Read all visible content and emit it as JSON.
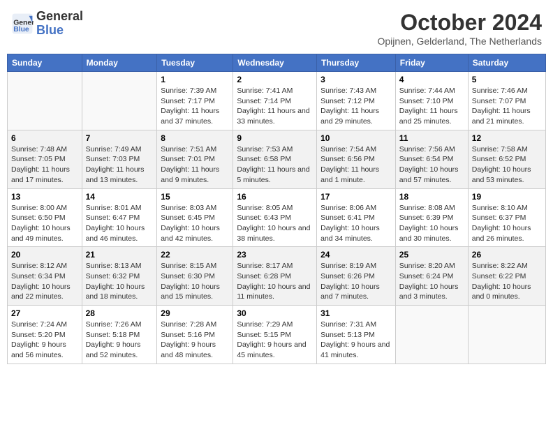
{
  "header": {
    "logo_line1": "General",
    "logo_line2": "Blue",
    "title": "October 2024",
    "subtitle": "Opijnen, Gelderland, The Netherlands"
  },
  "days_of_week": [
    "Sunday",
    "Monday",
    "Tuesday",
    "Wednesday",
    "Thursday",
    "Friday",
    "Saturday"
  ],
  "weeks": [
    [
      {
        "num": "",
        "info": ""
      },
      {
        "num": "",
        "info": ""
      },
      {
        "num": "1",
        "info": "Sunrise: 7:39 AM\nSunset: 7:17 PM\nDaylight: 11 hours and 37 minutes."
      },
      {
        "num": "2",
        "info": "Sunrise: 7:41 AM\nSunset: 7:14 PM\nDaylight: 11 hours and 33 minutes."
      },
      {
        "num": "3",
        "info": "Sunrise: 7:43 AM\nSunset: 7:12 PM\nDaylight: 11 hours and 29 minutes."
      },
      {
        "num": "4",
        "info": "Sunrise: 7:44 AM\nSunset: 7:10 PM\nDaylight: 11 hours and 25 minutes."
      },
      {
        "num": "5",
        "info": "Sunrise: 7:46 AM\nSunset: 7:07 PM\nDaylight: 11 hours and 21 minutes."
      }
    ],
    [
      {
        "num": "6",
        "info": "Sunrise: 7:48 AM\nSunset: 7:05 PM\nDaylight: 11 hours and 17 minutes."
      },
      {
        "num": "7",
        "info": "Sunrise: 7:49 AM\nSunset: 7:03 PM\nDaylight: 11 hours and 13 minutes."
      },
      {
        "num": "8",
        "info": "Sunrise: 7:51 AM\nSunset: 7:01 PM\nDaylight: 11 hours and 9 minutes."
      },
      {
        "num": "9",
        "info": "Sunrise: 7:53 AM\nSunset: 6:58 PM\nDaylight: 11 hours and 5 minutes."
      },
      {
        "num": "10",
        "info": "Sunrise: 7:54 AM\nSunset: 6:56 PM\nDaylight: 11 hours and 1 minute."
      },
      {
        "num": "11",
        "info": "Sunrise: 7:56 AM\nSunset: 6:54 PM\nDaylight: 10 hours and 57 minutes."
      },
      {
        "num": "12",
        "info": "Sunrise: 7:58 AM\nSunset: 6:52 PM\nDaylight: 10 hours and 53 minutes."
      }
    ],
    [
      {
        "num": "13",
        "info": "Sunrise: 8:00 AM\nSunset: 6:50 PM\nDaylight: 10 hours and 49 minutes."
      },
      {
        "num": "14",
        "info": "Sunrise: 8:01 AM\nSunset: 6:47 PM\nDaylight: 10 hours and 46 minutes."
      },
      {
        "num": "15",
        "info": "Sunrise: 8:03 AM\nSunset: 6:45 PM\nDaylight: 10 hours and 42 minutes."
      },
      {
        "num": "16",
        "info": "Sunrise: 8:05 AM\nSunset: 6:43 PM\nDaylight: 10 hours and 38 minutes."
      },
      {
        "num": "17",
        "info": "Sunrise: 8:06 AM\nSunset: 6:41 PM\nDaylight: 10 hours and 34 minutes."
      },
      {
        "num": "18",
        "info": "Sunrise: 8:08 AM\nSunset: 6:39 PM\nDaylight: 10 hours and 30 minutes."
      },
      {
        "num": "19",
        "info": "Sunrise: 8:10 AM\nSunset: 6:37 PM\nDaylight: 10 hours and 26 minutes."
      }
    ],
    [
      {
        "num": "20",
        "info": "Sunrise: 8:12 AM\nSunset: 6:34 PM\nDaylight: 10 hours and 22 minutes."
      },
      {
        "num": "21",
        "info": "Sunrise: 8:13 AM\nSunset: 6:32 PM\nDaylight: 10 hours and 18 minutes."
      },
      {
        "num": "22",
        "info": "Sunrise: 8:15 AM\nSunset: 6:30 PM\nDaylight: 10 hours and 15 minutes."
      },
      {
        "num": "23",
        "info": "Sunrise: 8:17 AM\nSunset: 6:28 PM\nDaylight: 10 hours and 11 minutes."
      },
      {
        "num": "24",
        "info": "Sunrise: 8:19 AM\nSunset: 6:26 PM\nDaylight: 10 hours and 7 minutes."
      },
      {
        "num": "25",
        "info": "Sunrise: 8:20 AM\nSunset: 6:24 PM\nDaylight: 10 hours and 3 minutes."
      },
      {
        "num": "26",
        "info": "Sunrise: 8:22 AM\nSunset: 6:22 PM\nDaylight: 10 hours and 0 minutes."
      }
    ],
    [
      {
        "num": "27",
        "info": "Sunrise: 7:24 AM\nSunset: 5:20 PM\nDaylight: 9 hours and 56 minutes."
      },
      {
        "num": "28",
        "info": "Sunrise: 7:26 AM\nSunset: 5:18 PM\nDaylight: 9 hours and 52 minutes."
      },
      {
        "num": "29",
        "info": "Sunrise: 7:28 AM\nSunset: 5:16 PM\nDaylight: 9 hours and 48 minutes."
      },
      {
        "num": "30",
        "info": "Sunrise: 7:29 AM\nSunset: 5:15 PM\nDaylight: 9 hours and 45 minutes."
      },
      {
        "num": "31",
        "info": "Sunrise: 7:31 AM\nSunset: 5:13 PM\nDaylight: 9 hours and 41 minutes."
      },
      {
        "num": "",
        "info": ""
      },
      {
        "num": "",
        "info": ""
      }
    ]
  ]
}
